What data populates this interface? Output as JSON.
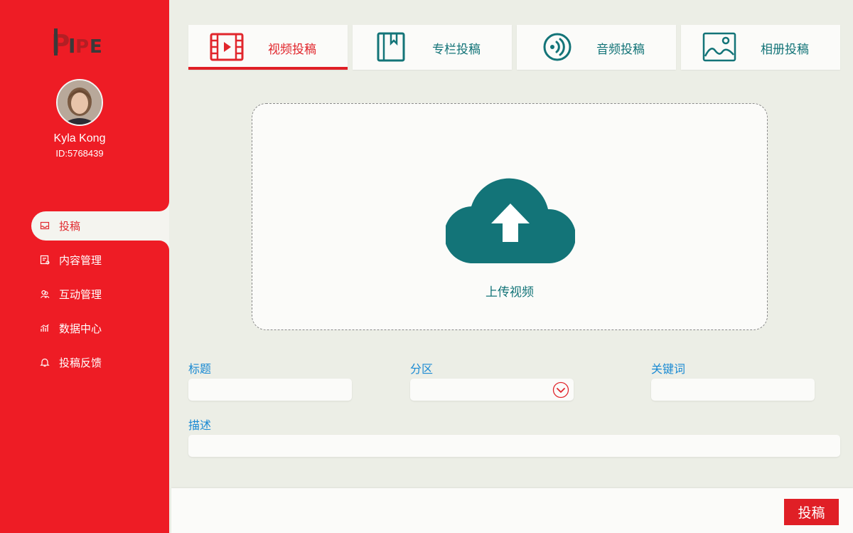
{
  "brand": {
    "logo_text": "PIPE",
    "accent": "#ee1c25",
    "teal": "#137478"
  },
  "user": {
    "name": "Kyla Kong",
    "id_label": "ID:5768439"
  },
  "sidebar": {
    "items": [
      {
        "label": "投稿",
        "icon": "inbox-icon",
        "active": true
      },
      {
        "label": "内容管理",
        "icon": "content-icon",
        "active": false
      },
      {
        "label": "互动管理",
        "icon": "users-icon",
        "active": false
      },
      {
        "label": "数据中心",
        "icon": "chart-icon",
        "active": false
      },
      {
        "label": "投稿反馈",
        "icon": "bell-icon",
        "active": false
      }
    ]
  },
  "tabs": [
    {
      "label": "视频投稿",
      "icon": "film-icon",
      "active": true
    },
    {
      "label": "专栏投稿",
      "icon": "book-icon",
      "active": false
    },
    {
      "label": "音频投稿",
      "icon": "audio-icon",
      "active": false
    },
    {
      "label": "相册投稿",
      "icon": "image-icon",
      "active": false
    }
  ],
  "upload": {
    "label": "上传视频",
    "icon": "cloud-upload-icon"
  },
  "form": {
    "title_label": "标题",
    "title_value": "",
    "category_label": "分区",
    "category_value": "",
    "keywords_label": "关键词",
    "keywords_value": "",
    "description_label": "描述",
    "description_value": ""
  },
  "footer": {
    "submit_label": "投稿"
  }
}
